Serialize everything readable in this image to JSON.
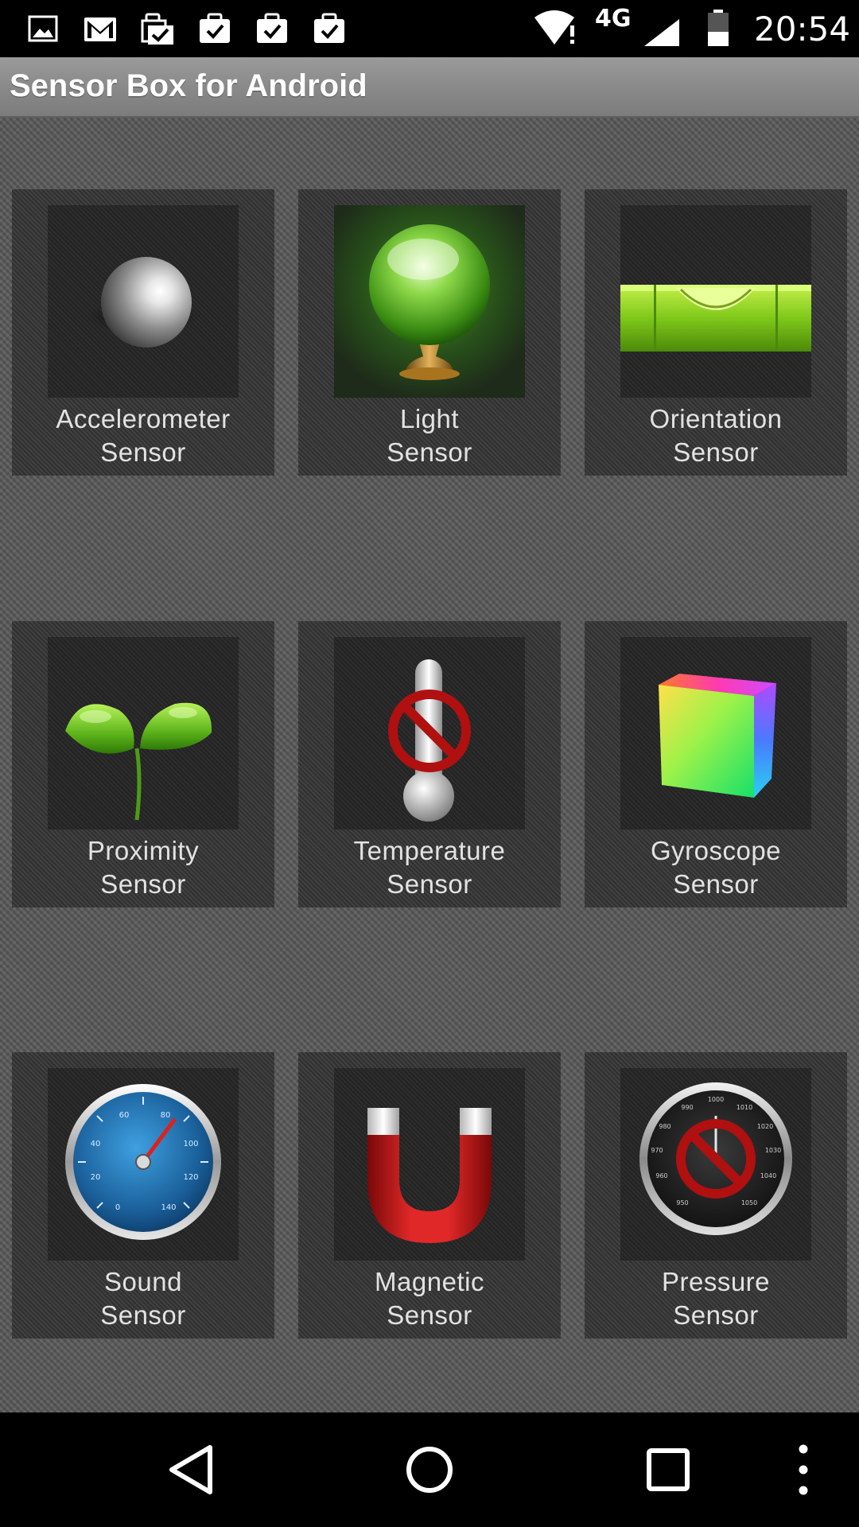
{
  "status_bar": {
    "network_label": "4G",
    "time": "20:54",
    "notification_icons": [
      "image-icon",
      "gmail-icon",
      "clipboard-check-icon",
      "briefcase-check-icon",
      "briefcase-check-icon",
      "briefcase-check-icon"
    ]
  },
  "app": {
    "title": "Sensor Box for Android"
  },
  "sensors": [
    {
      "line1": "Accelerometer",
      "line2": "Sensor",
      "icon": "steel-ball-icon"
    },
    {
      "line1": "Light",
      "line2": "Sensor",
      "icon": "crystal-ball-icon"
    },
    {
      "line1": "Orientation",
      "line2": "Sensor",
      "icon": "spirit-level-icon"
    },
    {
      "line1": "Proximity",
      "line2": "Sensor",
      "icon": "sprout-icon"
    },
    {
      "line1": "Temperature",
      "line2": "Sensor",
      "icon": "thermometer-disabled-icon"
    },
    {
      "line1": "Gyroscope",
      "line2": "Sensor",
      "icon": "color-cube-icon"
    },
    {
      "line1": "Sound",
      "line2": "Sensor",
      "icon": "speedometer-gauge-icon"
    },
    {
      "line1": "Magnetic",
      "line2": "Sensor",
      "icon": "horseshoe-magnet-icon"
    },
    {
      "line1": "Pressure",
      "line2": "Sensor",
      "icon": "barometer-disabled-icon"
    }
  ],
  "gauge_ticks": [
    "0",
    "20",
    "40",
    "60",
    "80",
    "100",
    "120",
    "140"
  ],
  "barometer_ticks": [
    "950",
    "960",
    "970",
    "980",
    "990",
    "1000",
    "1010",
    "1020",
    "1030",
    "1040",
    "1050"
  ],
  "colors": {
    "accent_green": "#7fd32a",
    "disabled_red": "#b01010",
    "magnet_red": "#c81818"
  }
}
